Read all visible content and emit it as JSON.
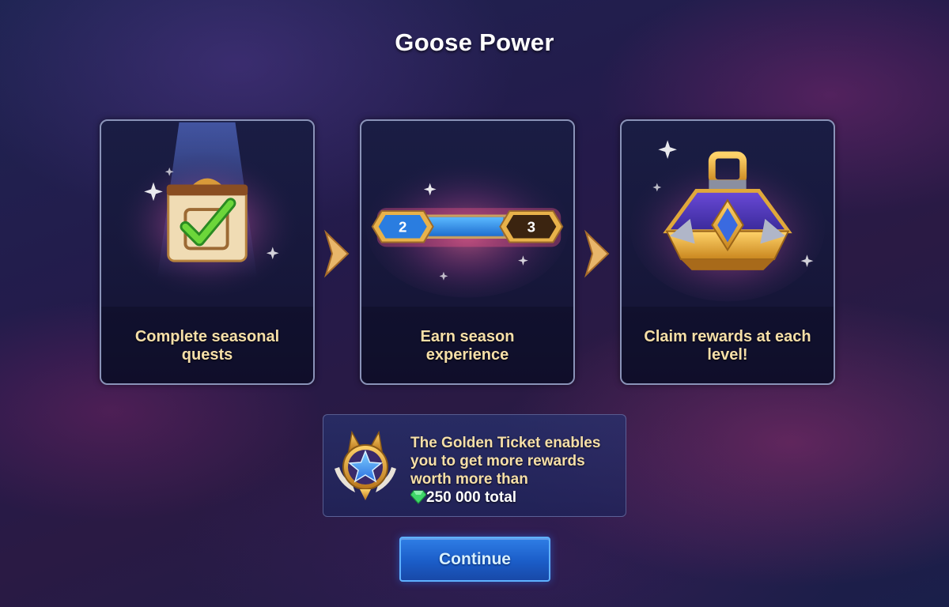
{
  "title": "Goose Power",
  "steps": [
    {
      "caption": "Complete seasonal quests",
      "icon": "quest-check-icon"
    },
    {
      "caption": "Earn season experience",
      "icon": "xp-bar-icon",
      "level_from": "2",
      "level_to": "3",
      "progress": 0.65
    },
    {
      "caption": "Claim rewards at each level!",
      "icon": "reward-chest-icon"
    }
  ],
  "info": {
    "line1": "The Golden Ticket enables",
    "line2": "you to get more rewards",
    "line3": "worth more than",
    "total": "250 000 total",
    "icon": "golden-ticket-emblem-icon",
    "currency_icon": "emerald-gem-icon"
  },
  "continue_label": "Continue",
  "colors": {
    "caption": "#f6dfa8",
    "button": "#1b5dc8",
    "accent_gold": "#e8a93c"
  }
}
